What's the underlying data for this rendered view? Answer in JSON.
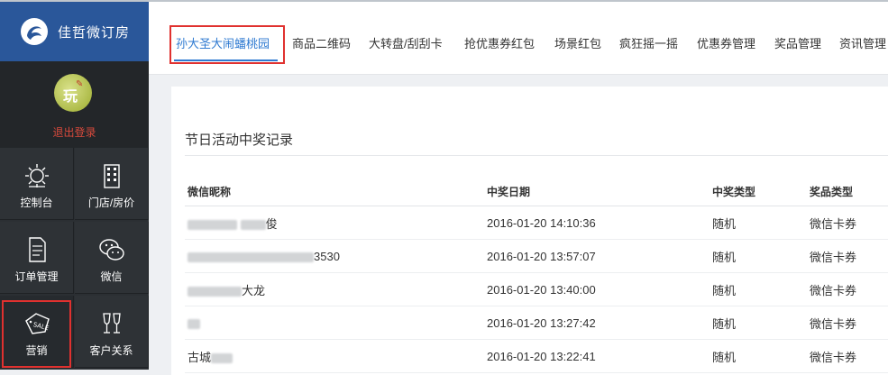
{
  "brand": {
    "name": "佳哲微订房"
  },
  "user": {
    "logout_label": "退出登录",
    "avatar_text": "玩"
  },
  "sidebar": {
    "items": [
      {
        "label": "控制台",
        "icon": "sun-gear-icon"
      },
      {
        "label": "门店/房价",
        "icon": "building-icon"
      },
      {
        "label": "订单管理",
        "icon": "document-icon"
      },
      {
        "label": "微信",
        "icon": "wechat-icon"
      },
      {
        "label": "营销",
        "icon": "sale-tag-icon"
      },
      {
        "label": "客户关系",
        "icon": "wine-glasses-icon"
      }
    ]
  },
  "tabs": [
    {
      "label": "孙大圣大闹蟠桃园"
    },
    {
      "label": "商品二维码"
    },
    {
      "label": "大转盘/刮刮卡"
    },
    {
      "label": "抢优惠券红包"
    },
    {
      "label": "场景红包"
    },
    {
      "label": "疯狂摇一摇"
    },
    {
      "label": "优惠券管理"
    },
    {
      "label": "奖品管理"
    },
    {
      "label": "资讯管理"
    }
  ],
  "panel": {
    "title": "节日活动中奖记录",
    "columns": [
      "微信昵称",
      "中奖日期",
      "中奖类型",
      "奖品类型"
    ],
    "rows": [
      {
        "nickname": "俊",
        "date": "2016-01-20 14:10:36",
        "type": "随机",
        "prize": "微信卡券"
      },
      {
        "nickname": "3530",
        "date": "2016-01-20 13:57:07",
        "type": "随机",
        "prize": "微信卡券"
      },
      {
        "nickname": "大龙",
        "date": "2016-01-20 13:40:00",
        "type": "随机",
        "prize": "微信卡券"
      },
      {
        "nickname": "",
        "date": "2016-01-20 13:27:42",
        "type": "随机",
        "prize": "微信卡券"
      },
      {
        "nickname": "古城",
        "date": "2016-01-20 13:22:41",
        "type": "随机",
        "prize": "微信卡券"
      }
    ]
  },
  "colors": {
    "brand_blue": "#2a579a",
    "accent_blue": "#2f7ad1",
    "logout_red": "#d84a3c",
    "highlight_red": "#e0312f"
  }
}
